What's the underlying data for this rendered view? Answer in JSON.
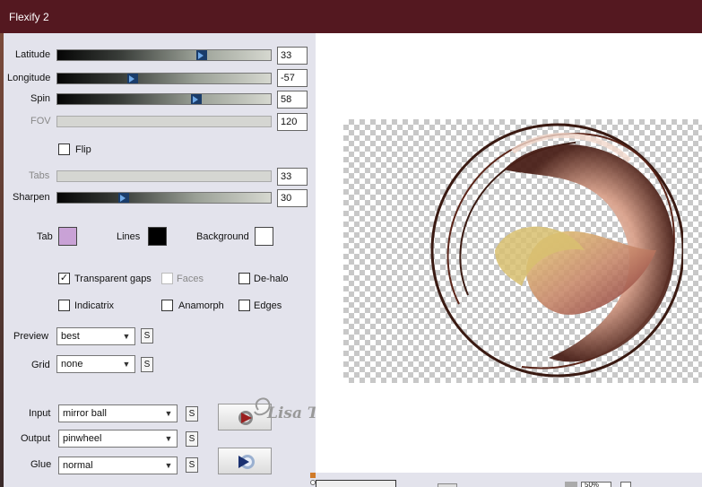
{
  "window": {
    "title": "Flexify 2"
  },
  "sliders": [
    {
      "label": "Latitude",
      "value": "33",
      "level": 0.69,
      "enabled": true
    },
    {
      "label": "Longitude",
      "value": "-57",
      "level": 0.35,
      "enabled": true
    },
    {
      "label": "Spin",
      "value": "58",
      "level": 0.65,
      "enabled": true
    },
    {
      "label": "FOV",
      "value": "120",
      "level": null,
      "enabled": false
    }
  ],
  "flip": {
    "label": "Flip",
    "checked": false
  },
  "sliders2": [
    {
      "label": "Tabs",
      "value": "33",
      "level": null,
      "enabled": false
    },
    {
      "label": "Sharpen",
      "value": "30",
      "level": 0.31,
      "enabled": true
    }
  ],
  "colors": {
    "tab_label": "Tab",
    "tab_color": "#c9a2d6",
    "lines_label": "Lines",
    "lines_color": "#000000",
    "background_label": "Background",
    "background_color": "#ffffff"
  },
  "options": {
    "transparent_gaps": {
      "label": "Transparent gaps",
      "checked": true
    },
    "faces": {
      "label": "Faces",
      "checked": false,
      "enabled": false
    },
    "de_halo": {
      "label": "De-halo",
      "checked": false
    },
    "indicatrix": {
      "label": "Indicatrix",
      "checked": false
    },
    "anamorph": {
      "label": "Anamorph",
      "checked": false
    },
    "edges": {
      "label": "Edges",
      "checked": false
    }
  },
  "preview": {
    "label": "Preview",
    "value": "best"
  },
  "grid": {
    "label": "Grid",
    "value": "none"
  },
  "input": {
    "label": "Input",
    "value": "mirror ball"
  },
  "output": {
    "label": "Output",
    "value": "pinwheel"
  },
  "glue": {
    "label": "Glue",
    "value": "normal"
  },
  "s_label": "S",
  "watermark": "Lisa T.",
  "zoom": "50%"
}
